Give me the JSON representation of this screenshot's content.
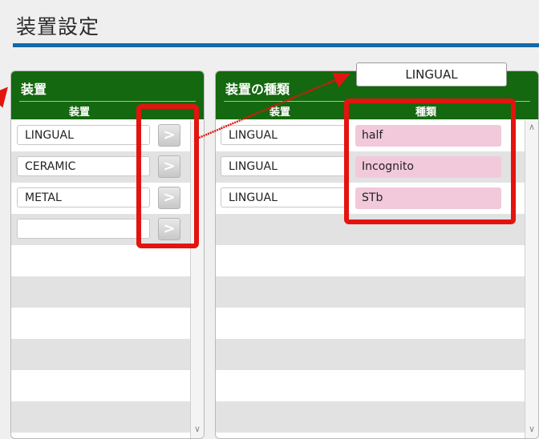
{
  "page": {
    "title": "装置設定"
  },
  "left_panel": {
    "title": "装置",
    "column_header": "装置",
    "rows": [
      {
        "value": "LINGUAL",
        "button": ">"
      },
      {
        "value": "CERAMIC",
        "button": ">"
      },
      {
        "value": "METAL",
        "button": ">"
      },
      {
        "value": "",
        "button": ">"
      }
    ]
  },
  "right_panel": {
    "title": "装置の種類",
    "column_headers": {
      "device": "装置",
      "type": "種類"
    },
    "rows": [
      {
        "device": "LINGUAL",
        "type": "half"
      },
      {
        "device": "LINGUAL",
        "type": "Incognito"
      },
      {
        "device": "LINGUAL",
        "type": "STb"
      }
    ]
  },
  "annotation": {
    "label": "LINGUAL"
  },
  "colors": {
    "header_green": "#14680f",
    "title_rule_blue": "#1468a8",
    "highlight_pink": "#f2c9da",
    "annotation_red": "#e3140f"
  },
  "icons": {
    "arrow_button": "chevron-right-icon",
    "scroll_up": "chevron-up-icon",
    "scroll_down": "chevron-down-icon"
  }
}
